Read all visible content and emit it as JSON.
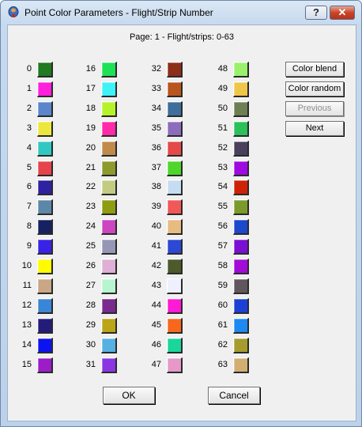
{
  "window": {
    "title": "Point Color Parameters - Flight/Strip Number",
    "help_label": "?",
    "close_label": "✕"
  },
  "page_info": "Page: 1 - Flight/strips: 0-63",
  "colors": [
    {
      "num": "0",
      "color": "#1f7a22"
    },
    {
      "num": "1",
      "color": "#ff1fdc"
    },
    {
      "num": "2",
      "color": "#5b86cc"
    },
    {
      "num": "3",
      "color": "#ece73c"
    },
    {
      "num": "4",
      "color": "#32c8c2"
    },
    {
      "num": "5",
      "color": "#e6434a"
    },
    {
      "num": "6",
      "color": "#2e22a0"
    },
    {
      "num": "7",
      "color": "#5c87a8"
    },
    {
      "num": "8",
      "color": "#152160"
    },
    {
      "num": "9",
      "color": "#3822e6"
    },
    {
      "num": "10",
      "color": "#fffb00"
    },
    {
      "num": "11",
      "color": "#c8a686"
    },
    {
      "num": "12",
      "color": "#3a86d6"
    },
    {
      "num": "13",
      "color": "#231c7a"
    },
    {
      "num": "14",
      "color": "#0c13f0"
    },
    {
      "num": "15",
      "color": "#9c1cc8"
    },
    {
      "num": "16",
      "color": "#1ee155"
    },
    {
      "num": "17",
      "color": "#3ef3f6"
    },
    {
      "num": "18",
      "color": "#b6f22a"
    },
    {
      "num": "19",
      "color": "#ff2aa8"
    },
    {
      "num": "20",
      "color": "#c08a4a"
    },
    {
      "num": "21",
      "color": "#8e9a2c"
    },
    {
      "num": "22",
      "color": "#c3cb82"
    },
    {
      "num": "23",
      "color": "#8e9c10"
    },
    {
      "num": "24",
      "color": "#cd45c1"
    },
    {
      "num": "25",
      "color": "#9697b4"
    },
    {
      "num": "26",
      "color": "#deb0d6"
    },
    {
      "num": "27",
      "color": "#b6f5cf"
    },
    {
      "num": "28",
      "color": "#7a2a8e"
    },
    {
      "num": "29",
      "color": "#bca418"
    },
    {
      "num": "30",
      "color": "#56b0e2"
    },
    {
      "num": "31",
      "color": "#8a36e2"
    },
    {
      "num": "32",
      "color": "#8c2e18"
    },
    {
      "num": "33",
      "color": "#b8561e"
    },
    {
      "num": "34",
      "color": "#3d6e9c"
    },
    {
      "num": "35",
      "color": "#8e6cbc"
    },
    {
      "num": "36",
      "color": "#e44a4a"
    },
    {
      "num": "37",
      "color": "#4ed62a"
    },
    {
      "num": "38",
      "color": "#c6dcf2"
    },
    {
      "num": "39",
      "color": "#f25858"
    },
    {
      "num": "40",
      "color": "#e6bc82"
    },
    {
      "num": "41",
      "color": "#2c48d4"
    },
    {
      "num": "42",
      "color": "#4d5a2c"
    },
    {
      "num": "43",
      "color": "#eef0fe"
    },
    {
      "num": "44",
      "color": "#ff1ad6"
    },
    {
      "num": "45",
      "color": "#f8681c"
    },
    {
      "num": "46",
      "color": "#1ad69a"
    },
    {
      "num": "47",
      "color": "#e698c8"
    },
    {
      "num": "48",
      "color": "#9af26c"
    },
    {
      "num": "49",
      "color": "#f0c64a"
    },
    {
      "num": "50",
      "color": "#6e7f52"
    },
    {
      "num": "51",
      "color": "#2ac05a"
    },
    {
      "num": "52",
      "color": "#4a405e"
    },
    {
      "num": "53",
      "color": "#9e0ae0"
    },
    {
      "num": "54",
      "color": "#ce2208"
    },
    {
      "num": "55",
      "color": "#7b9a2c"
    },
    {
      "num": "56",
      "color": "#1c48cc"
    },
    {
      "num": "57",
      "color": "#7a0ed2"
    },
    {
      "num": "58",
      "color": "#a20ad8"
    },
    {
      "num": "59",
      "color": "#62565e"
    },
    {
      "num": "60",
      "color": "#1c40d6"
    },
    {
      "num": "61",
      "color": "#1c8af0"
    },
    {
      "num": "62",
      "color": "#a69c2e"
    },
    {
      "num": "63",
      "color": "#d2ae72"
    }
  ],
  "side_buttons": {
    "color_blend": "Color blend",
    "color_random": "Color random",
    "previous": "Previous",
    "next": "Next"
  },
  "footer": {
    "ok": "OK",
    "cancel": "Cancel"
  }
}
